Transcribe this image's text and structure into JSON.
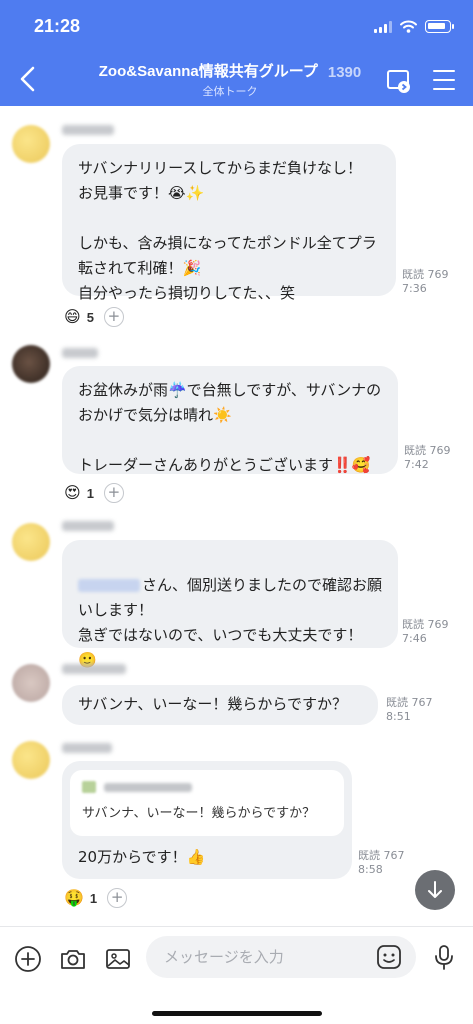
{
  "status_bar": {
    "time": "21:28"
  },
  "header": {
    "title": "Zoo&Savanna情報共有グループ",
    "member_count": "1390",
    "subtitle": "全体トーク"
  },
  "messages": [
    {
      "text": "サバンナリリースしてからまだ負けなし！\nお見事です！😭✨\n\nしかも、含み損になってたポンドル全てプラ転されて利確！🎉\n自分やったら損切りしてた、、笑",
      "read": "既読 769",
      "time": "7:36",
      "reaction": {
        "emoji": "😄",
        "count": "5"
      }
    },
    {
      "text": "お盆休みが雨☔️で台無しですが、サバンナのおかげで気分は晴れ☀️\n\nトレーダーさんありがとうございます‼️🥰",
      "read": "既読 769",
      "time": "7:42",
      "reaction": {
        "emoji": "😍",
        "count": "1"
      }
    },
    {
      "text": "さん、個別送りましたので確認お願いします！\n急ぎではないので、いつでも大丈夫です！\n🙂",
      "read": "既読 769",
      "time": "7:46"
    },
    {
      "text": "サバンナ、いーなー！幾らからですか？",
      "read": "既読 767",
      "time": "8:51"
    },
    {
      "quote": "サバンナ、いーなー！幾らからですか？",
      "text": "20万からです！👍",
      "read": "既読 767",
      "time": "8:58",
      "reaction": {
        "emoji": "🤑",
        "count": "1"
      }
    }
  ],
  "input": {
    "placeholder": "メッセージを入力"
  },
  "colors": {
    "header": "#4f7cf0",
    "bubble": "#eef0f3"
  },
  "icons": [
    "back-icon",
    "video-call-icon",
    "menu-icon",
    "plus-icon",
    "camera-icon",
    "image-icon",
    "sticker-icon",
    "microphone-icon",
    "scroll-down-icon"
  ]
}
